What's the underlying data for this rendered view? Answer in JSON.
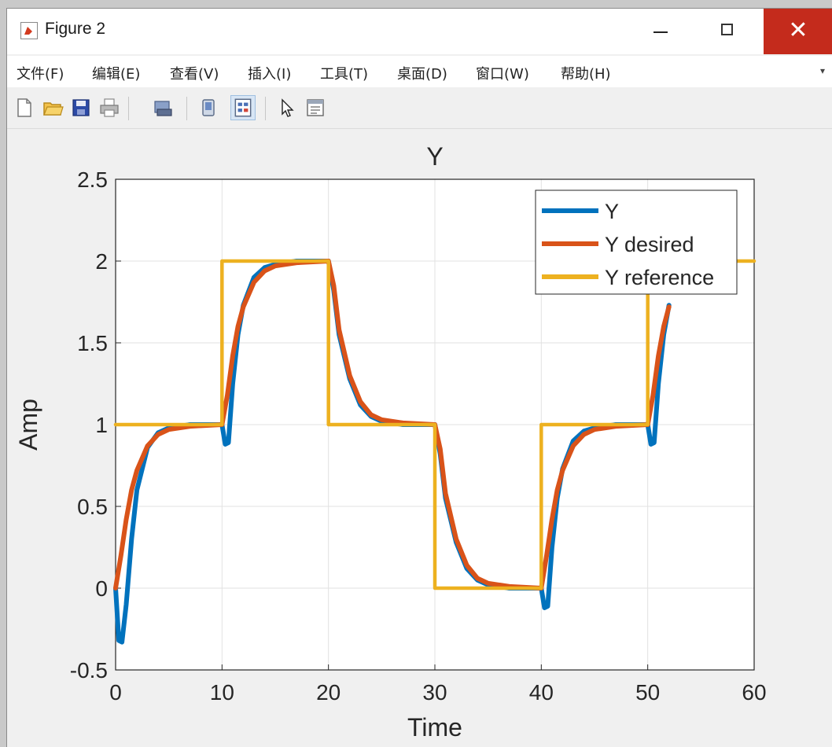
{
  "window": {
    "title": "Figure 2",
    "close_glyph": "✕"
  },
  "menu": {
    "items": [
      "文件(F)",
      "编辑(E)",
      "查看(V)",
      "插入(I)",
      "工具(T)",
      "桌面(D)",
      "窗口(W)",
      "帮助(H)"
    ],
    "overflow_glyph": "▾"
  },
  "toolbar": {
    "icons": [
      "new-figure-icon",
      "open-file-icon",
      "save-icon",
      "print-icon",
      "link-plot-icon",
      "hide-plot-tools-icon",
      "show-plot-tools-icon",
      "edit-plot-icon",
      "open-property-inspector-icon"
    ]
  },
  "chart_data": {
    "type": "line",
    "title": "Y",
    "xlabel": "Time",
    "ylabel": "Amp",
    "xlim": [
      0,
      60
    ],
    "ylim": [
      -0.5,
      2.5
    ],
    "xticks": [
      "0",
      "10",
      "20",
      "30",
      "40",
      "50",
      "60"
    ],
    "yticks": [
      "-0.5",
      "0",
      "0.5",
      "1",
      "1.5",
      "2",
      "2.5"
    ],
    "grid": true,
    "legend_position": "top-right",
    "series": [
      {
        "name": "Y",
        "color": "#0072BD",
        "x": [
          0,
          0.3,
          0.6,
          1,
          1.5,
          2,
          3,
          4,
          5,
          7,
          10,
          10.3,
          10.6,
          11,
          11.5,
          12,
          13,
          14,
          15,
          17,
          20,
          20.5,
          21,
          22,
          23,
          24,
          25,
          27,
          30,
          30.5,
          31,
          32,
          33,
          34,
          35,
          37,
          40,
          40.3,
          40.6,
          41,
          41.5,
          42,
          43,
          44,
          45,
          47,
          50,
          50.3,
          50.6,
          51,
          51.5,
          52
        ],
        "y": [
          0,
          -0.32,
          -0.33,
          -0.1,
          0.3,
          0.6,
          0.86,
          0.95,
          0.98,
          1.0,
          1.0,
          0.88,
          0.89,
          1.25,
          1.55,
          1.73,
          1.9,
          1.96,
          1.98,
          2.0,
          2.0,
          1.82,
          1.55,
          1.28,
          1.12,
          1.05,
          1.02,
          1.0,
          1.0,
          0.82,
          0.55,
          0.28,
          0.12,
          0.05,
          0.02,
          0.0,
          0.0,
          -0.12,
          -0.11,
          0.25,
          0.55,
          0.73,
          0.9,
          0.96,
          0.98,
          1.0,
          1.0,
          0.88,
          0.89,
          1.25,
          1.55,
          1.73
        ]
      },
      {
        "name": "Y desired",
        "color": "#D95319",
        "x": [
          0,
          0.5,
          1,
          1.5,
          2,
          3,
          4,
          5,
          7,
          10,
          10.5,
          11,
          11.5,
          12,
          13,
          14,
          15,
          17,
          20,
          20.5,
          21,
          22,
          23,
          24,
          25,
          27,
          30,
          30.5,
          31,
          32,
          33,
          34,
          35,
          37,
          40,
          40.5,
          41,
          41.5,
          42,
          43,
          44,
          45,
          47,
          50,
          50.5,
          51,
          51.5,
          52
        ],
        "y": [
          0,
          0.2,
          0.42,
          0.6,
          0.72,
          0.87,
          0.94,
          0.97,
          0.99,
          1.0,
          1.18,
          1.42,
          1.6,
          1.72,
          1.87,
          1.94,
          1.97,
          1.99,
          2.0,
          1.85,
          1.58,
          1.3,
          1.14,
          1.06,
          1.03,
          1.01,
          1.0,
          0.85,
          0.58,
          0.3,
          0.14,
          0.06,
          0.03,
          0.01,
          0.0,
          0.2,
          0.42,
          0.6,
          0.72,
          0.87,
          0.94,
          0.97,
          0.99,
          1.0,
          1.18,
          1.42,
          1.6,
          1.72
        ]
      },
      {
        "name": "Y reference",
        "color": "#EDB120",
        "x": [
          0,
          10,
          10,
          20,
          20,
          30,
          30,
          40,
          40,
          50,
          50,
          60
        ],
        "y": [
          1,
          1,
          2,
          2,
          1,
          1,
          0,
          0,
          1,
          1,
          2,
          2
        ]
      }
    ]
  }
}
